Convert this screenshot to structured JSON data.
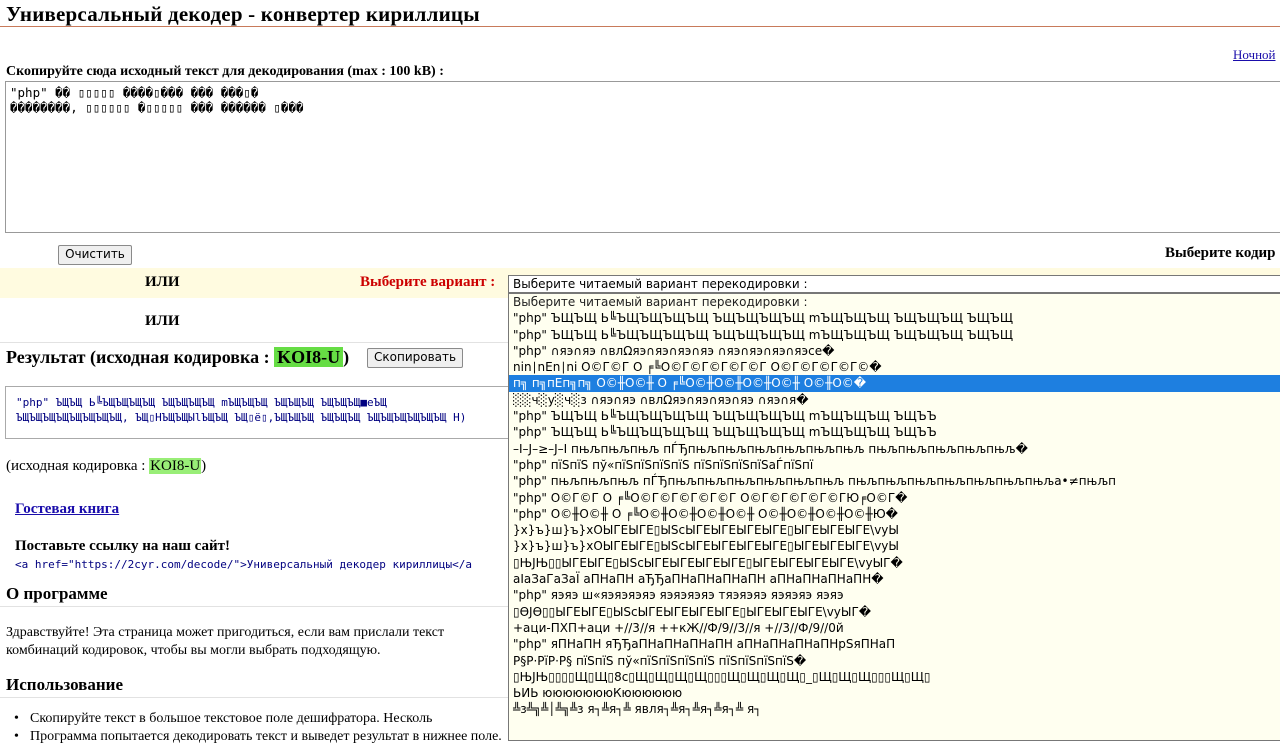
{
  "page": {
    "title": "Универсальный декодер - конвертер кириллицы",
    "night_link": "Ночной"
  },
  "source": {
    "label": "Скопируйте сюда исходный текст для декодирования (max : 100 kB) :",
    "lines": [
      "\"php\" �� ▯▯▯▯▯ ����▯��� ��� ���▯�",
      "��������, ▯▯▯▯▯▯ �▯▯▯▯▯ ��� ������ ▯���"
    ]
  },
  "controls": {
    "clear_label": "Очистить",
    "choose_encoding_label": "Выберите кодир",
    "or_label": "ИЛИ",
    "choose_variant_label": "Выберите вариант :",
    "select_value": "Выберите читаемый вариант перекодировки :",
    "or_label_2": "ИЛИ"
  },
  "result": {
    "heading_prefix": "Результат (исходная кодировка : ",
    "encoding": "KOI8-U",
    "heading_suffix": ")",
    "copy_label": "Скопировать",
    "lines": [
      "\"php\" ЪЩЪЩ Ь╚ЪЩЪЩЪЩЪЩ ЪЩЪЩЪЩЪЩ mЪЩЪЩЪЩ ЪЩЪЩЪЩ ЪЩЪЩЪЩ■еЪЩ",
      "ЪЩЪЩЪЩЪЩЪЩЪЩЪЩЪЩ, ЪЩ▯НЪЩЪЩЫlЪЩЪЩ ЪЩ▯ё▯,ЪЩЪЩЪЩ ЪЩЪЩЪЩ ЪЩЪЩЪЩЪЩЪЩЪЩ Н)"
    ],
    "source_encoding_prefix": "(исходная кодировка : ",
    "source_encoding": "KOI8-U",
    "source_encoding_suffix": ")"
  },
  "guestbook": {
    "label": "Гостевая книга"
  },
  "link_section": {
    "heading": "Поставьте ссылку на наш сайт!",
    "code": "<a href=\"https://2cyr.com/decode/\">Универсальный декодер кириллицы</a"
  },
  "about": {
    "heading": "О программе",
    "para_line1": "Здравствуйте! Эта страница может пригодиться, если вам прислали текст",
    "para_line2": "комбинаций кодировок, чтобы вы могли выбрать подходящую."
  },
  "usage": {
    "heading": "Использование",
    "items": [
      "Скопируйте текст в большое текстовое поле дешифратора. Несколь",
      "Программа попытается декодировать текст и выведет результат в нижнее поле."
    ]
  },
  "dropdown": {
    "selected_index": 5,
    "options": [
      "Выберите читаемый вариант перекодировки :",
      "\"php\" ЪЩЪЩ Ь╚ЪЩЪЩЪЩЪЩ ЪЩЪЩЪЩЪЩ mЪЩЪЩЪЩ ЪЩЪЩЪЩ ЪЩЪЩ",
      "\"php\" ЪЩЪЩ Ь╚ЪЩЪЩЪЩЪЩ ЪЩЪЩЪЩЪЩ mЪЩЪЩЪЩ ЪЩЪЩЪЩ ЪЩЪЩ",
      "\"php\" ∩яэ∩яэ ∩влΩяэ∩яэ∩яэ∩яэ ∩яэ∩яэ∩яэ∩яэсе�",
      "nin∣nEn∣ni О©Г©Г О ╒╚О©Г©Г©Г©Г©Г О©Г©Г©Г©Г©�",
      "п╗ п╗пЕп╗п╗ О©╫О©╫ О ╒╚О©╫О©╫О©╫О©╫ О©╫О©�",
      "░░ч░у░ч░з ∩яэ∩яэ ∩влΩяэ∩яэ∩яэ∩яэ ∩яэ∩я�",
      "\"php\" ЪЩЪЩ Ь╚ЪЩЪЩЪЩЪЩ ЪЩЪЩЪЩЪЩ mЪЩЪЩЪЩ ЪЩЪЪ",
      "\"php\" ЪЩЪЩ Ь╚ЪЩЪЩЪЩЪЩ ЪЩЪЩЪЩЪЩ mЪЩЪЩЪЩ ЪЩЪЪ",
      "–I–J–≥–J–I пњљпњљпњљ пЃЂпњљпњљпњљпњљпњљпњљ пњљпњљпњљпњљпњљ�",
      "\"php\" пїЅпїЅ пў«пїЅпїЅпїЅпїЅ пїЅпїЅпїЅпїЅаЃпїЅпї",
      "\"php\" пњљпњљпњљ пЃЂпњљпњљпњљпњљпњљпњљ пњљпњљпњљпњљпњљпњљпњља•≠пњљп",
      "\"php\" О©Г©Г О ╒╚О©Г©Г©Г©Г©Г О©Г©Г©Г©Г©ГЮ╒О©Г�",
      "\"php\" О©╫О©╫ О ╒╚О©╫О©╫О©╫О©╫ О©╫О©╫О©╫О©╫Ю�",
      "}х}ъ}ш}ъ}хОЫГЕЫГЕ▯ЫЅсЫГЕЫГЕЫГЕЫГЕ▯ЫГЕЫГЕЫГЕ\\vуЫ",
      "}х}ъ}ш}ъ}хОЫГЕЫГЕ▯ЫЅсЫГЕЫГЕЫГЕЫГЕ▯ЫГЕЫГЕЫГЕ\\vуЫ",
      "▯ЊЈЊ▯▯ЫГЕЫГЕ▯ЫЅсЫГЕЫГЕЫГЕЫГЕ▯ЫГЕЫГЕЫГЕЫГЕ\\vуЫГ�",
      "аІаЗаГаЗаЇ аПНаПН аЂЂаПНаПНаПНаПН аПНаПНаПНаПН�",
      "\"php\" яэяэ ш«яэяэяэяэ яэяэяэяэ тяэяэяэ яэяэяэ яэяэ",
      "▯ӨЈӨ▯▯ЫГЕЫГЕ▯ЫЅсЫГЕЫГЕЫГЕЫГЕ▯ЫГЕЫГЕЫГЕ\\vуЫГ�",
      "+аци-ПХП+аци +//3//я ++кЖ//Ф/9//3//я +//3//Ф/9//0й",
      "\"php\" яПНаПН яЂЂаПНаПНаПНаПН аПНаПНаПНаПНрЅяПНаП",
      "Р§Р·РїР·Р§ пїЅпїЅ пў«пїЅпїЅпїЅпїЅ пїЅпїЅпїЅпїЅ�",
      "▯ЊЈЊ▯▯▯▯Щ▯Щ▯8с▯Щ▯Щ▯Щ▯Щ▯▯▯Щ▯Щ▯Щ▯Щ▯_▯Щ▯Щ▯Щ▯▯▯Щ▯Щ▯",
      "  ЬИЬ  юююююююКюююююю",
      "╩з╩╗╩│╩╗╩з я┐╩я┐╩ явля┐╩я┐╩я┐╩я┐╩ я┐"
    ]
  }
}
